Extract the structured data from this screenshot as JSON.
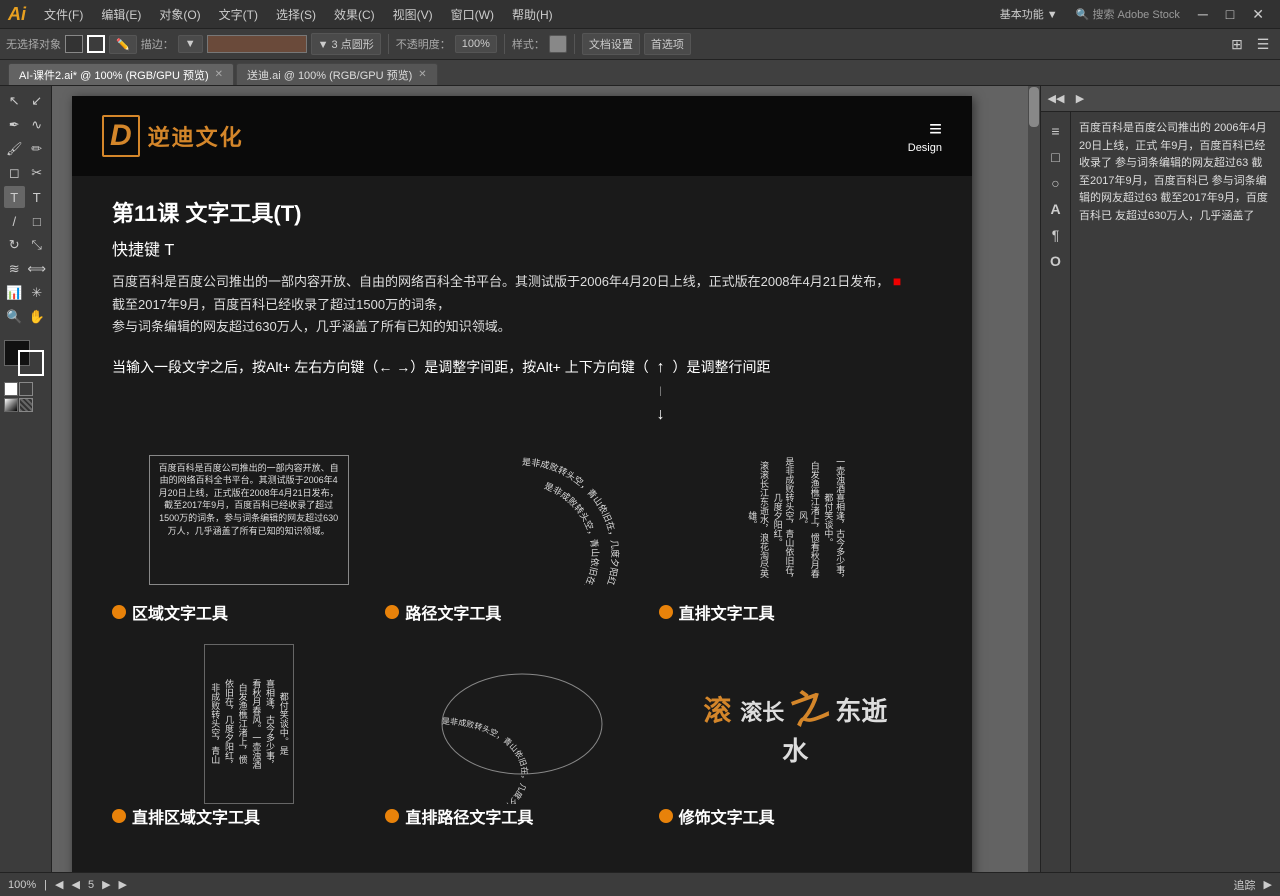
{
  "app": {
    "logo": "Ai",
    "logo_color": "#e8a020"
  },
  "menu": {
    "items": [
      "文件(F)",
      "编辑(E)",
      "对象(O)",
      "文字(T)",
      "选择(S)",
      "效果(C)",
      "视图(V)",
      "窗口(W)",
      "帮助(H)"
    ]
  },
  "toolbar": {
    "no_select": "无选择对象",
    "blend": "描边：",
    "points_label": "▼ 3 点圆形",
    "opacity_label": "不透明度：",
    "opacity_value": "100%",
    "style_label": "样式：",
    "doc_settings": "文档设置",
    "preferences": "首选项"
  },
  "tabs": [
    {
      "label": "AI-课件2.ai* @ 100% (RGB/GPU 预览)",
      "active": true
    },
    {
      "label": "送迪.ai @ 100% (RGB/GPU 预览)",
      "active": false
    }
  ],
  "document": {
    "header": {
      "logo_letter": "D",
      "logo_name": "逆迪文化",
      "menu_lines": "≡",
      "design_label": "Design"
    },
    "lesson": {
      "title": "第11课   文字工具(T)",
      "shortcut": "快捷键 T",
      "body_text_1": "百度百科是百度公司推出的一部内容开放、自由的网络百科全书平台。其测试版于2006年4月20日上线，正式版在2008年4月21日发布，",
      "body_text_2": "截至2017年9月，百度百科已经收录了超过1500万的词条，",
      "body_text_3": "参与词条编辑的网友超过630万人，几乎涵盖了所有已知的知识领域。",
      "tip_text": "当输入一段文字之后，按Alt+ 左右方向键（← →）是调整字间距，按Alt+ 上下方向键（  ）是调整行间距"
    },
    "tools": [
      {
        "name": "区域文字工具",
        "type": "region"
      },
      {
        "name": "路径文字工具",
        "type": "path"
      },
      {
        "name": "直排文字工具",
        "type": "vertical"
      }
    ],
    "tools_bottom": [
      {
        "name": "直排区域文字工具",
        "type": "vert-region"
      },
      {
        "name": "直排路径文字工具",
        "type": "vert-path"
      },
      {
        "name": "修饰文字工具",
        "type": "decoration"
      }
    ],
    "region_text": "百度百科是百度公司推出的一部内容开放、自由的网络百科全书平台。其测试版于2006年4月20日上线，正式版在2008年4月21日发布，截至2017年9月，百度百科已经收录了超过1500万的词条，参与词条编辑的网友超过630万人，几乎涵盖了所有已知的知识领域。",
    "path_text": "是非成败转头空，青山依旧在，几度夕阳红。白发渔樵江渚上，惯看秋月春风。一壶浊酒喜相逢，古今多少事，都付笑谈中。",
    "vertical_text": "滚滚长江东逝水，浪花淘尽英雄。是非成败转头空，青山依旧在，几度夕阳红。白发渔樵江渚上，惯看秋月春风。"
  },
  "right_panel": {
    "text": "百度百科是百度公司推出的 2006年4月20日上线，正式 年9月，百度百科已经收录了 参与词条编辑的网友超过63 截至2017年9月，百度百科已 参与词条编辑的网友超过63 截至2017年9月，百度百科已 友超过630万人，几乎涵盖了"
  },
  "status_bar": {
    "zoom": "100%",
    "page": "5"
  }
}
